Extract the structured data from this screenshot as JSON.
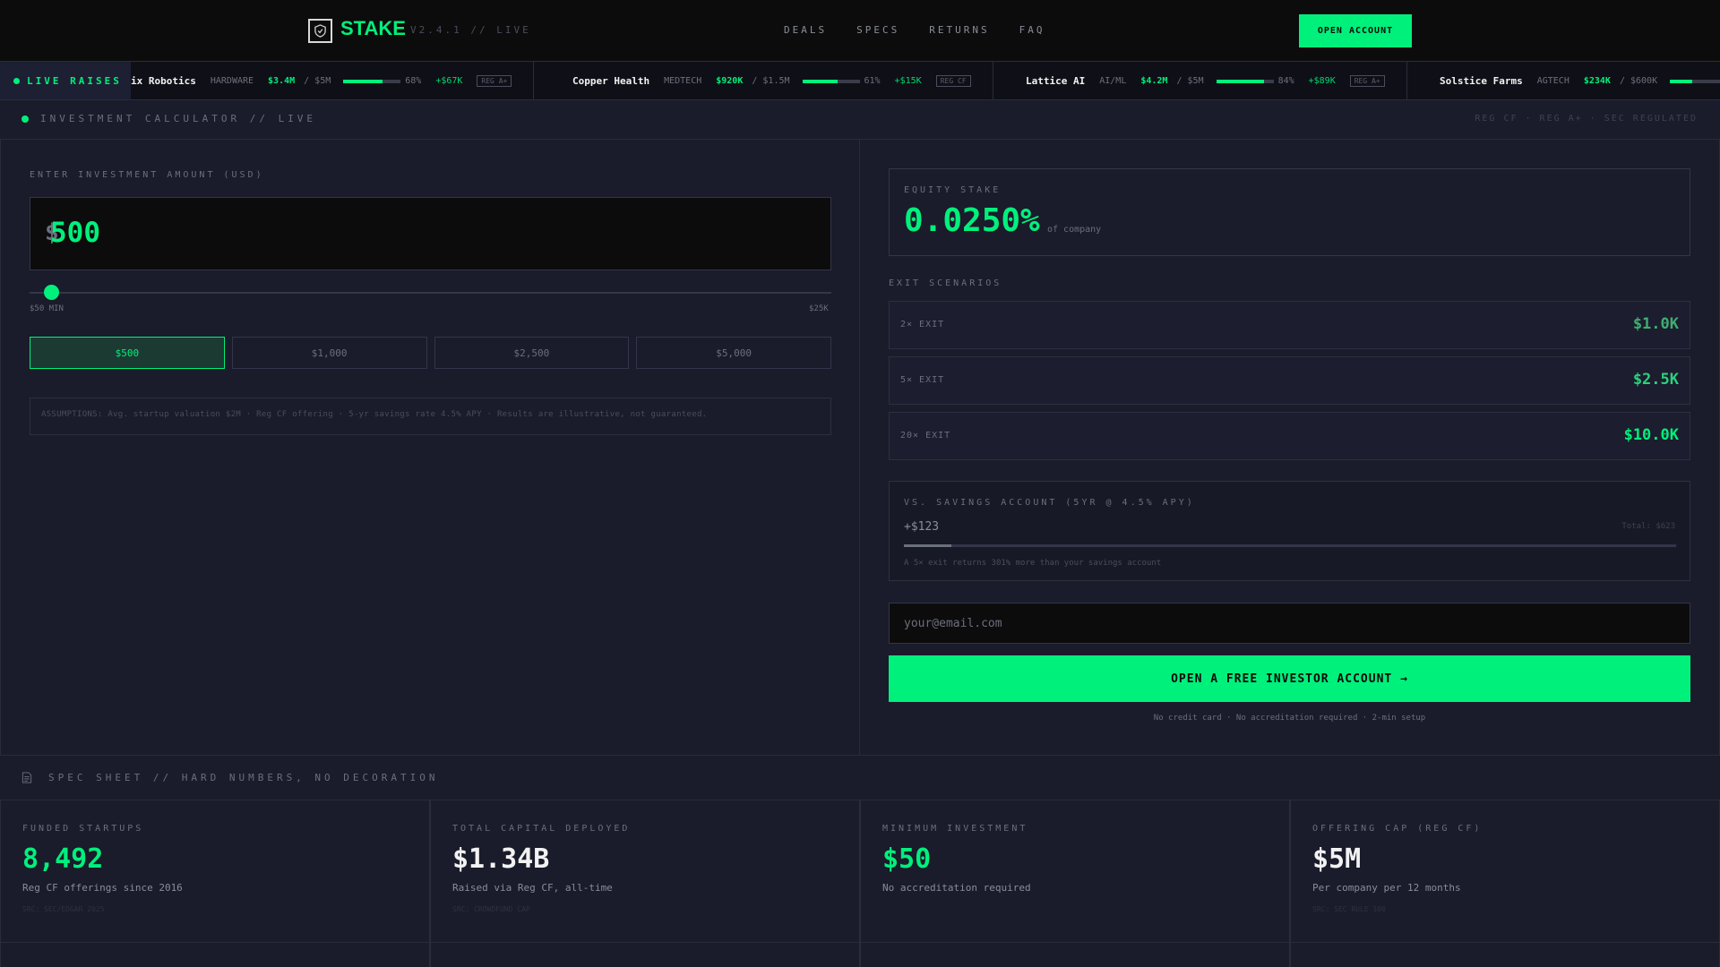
{
  "colors": {
    "accent": "#00f07c",
    "bg": "#1a1b2b",
    "header_bg": "#0c0c0c"
  },
  "header": {
    "logo_icon": "shield-icon",
    "brand": "STAKE",
    "version": "V2.4.1 // LIVE",
    "nav": [
      "DEALS",
      "SPECS",
      "RETURNS",
      "FAQ"
    ],
    "cta": "OPEN ACCOUNT"
  },
  "ticker": {
    "label": "LIVE RAISES",
    "items": [
      {
        "name": "ix Robotics",
        "sector": "HARDWARE",
        "raised": "$3.4M",
        "goal": "/ $5M",
        "progress": 0.68,
        "pct": "68%",
        "delta": "+$67K",
        "reg": "REG A+"
      },
      {
        "name": "Copper Health",
        "sector": "MEDTECH",
        "raised": "$920K",
        "goal": "/ $1.5M",
        "progress": 0.61,
        "pct": "61%",
        "delta": "+$15K",
        "reg": "REG CF"
      },
      {
        "name": "Lattice AI",
        "sector": "AI/ML",
        "raised": "$4.2M",
        "goal": "/ $5M",
        "progress": 0.84,
        "pct": "84%",
        "delta": "+$89K",
        "reg": "REG A+"
      },
      {
        "name": "Solstice Farms",
        "sector": "AGTECH",
        "raised": "$234K",
        "goal": "/ $600K",
        "progress": 0.39
      }
    ]
  },
  "calculator": {
    "title": "INVESTMENT CALCULATOR // LIVE",
    "reg_note": "REG CF · REG A+ · SEC REGULATED",
    "input_label": "ENTER INVESTMENT AMOUNT (USD)",
    "currency": "$",
    "amount": "500",
    "slider_min": "$50 MIN",
    "slider_max": "$25K",
    "slider_value": 0.018,
    "presets": [
      "$500",
      "$1,000",
      "$2,500",
      "$5,000"
    ],
    "assumptions": "ASSUMPTIONS: Avg. startup valuation $2M · Reg CF offering · 5-yr savings rate 4.5% APY · Results are illustrative, not guaranteed."
  },
  "results": {
    "equity_label": "EQUITY STAKE",
    "equity_value": "0.0250%",
    "equity_sub": "of company",
    "exit_label": "EXIT SCENARIOS",
    "exits": [
      {
        "label": "2× EXIT",
        "value": "$1.0K"
      },
      {
        "label": "5× EXIT",
        "value": "$2.5K"
      },
      {
        "label": "20× EXIT",
        "value": "$10.0K"
      }
    ],
    "savings_label": "VS. SAVINGS ACCOUNT (5YR @ 4.5% APY)",
    "savings_gain": "+$123",
    "savings_total": "Total: $623",
    "savings_progress": 0.062,
    "savings_note": "A 5× exit returns 301% more than your savings account",
    "email_placeholder": "your@email.com",
    "cta": "OPEN A FREE INVESTOR ACCOUNT →",
    "fine_print": "No credit card · No accreditation required · 2-min setup"
  },
  "spec": {
    "title": "SPEC SHEET // HARD NUMBERS, NO DECORATION",
    "icon": "document-icon",
    "stats": [
      {
        "label": "FUNDED STARTUPS",
        "value": "8,492",
        "desc": "Reg CF offerings since 2016",
        "source": "SRC: SEC/EDGAR 2025"
      },
      {
        "label": "TOTAL CAPITAL DEPLOYED",
        "value": "$1.34B",
        "desc": "Raised via Reg CF, all-time",
        "source": "SRC: CROWDFUND CAP"
      },
      {
        "label": "MINIMUM INVESTMENT",
        "value": "$50",
        "desc": "No accreditation required",
        "source": ""
      },
      {
        "label": "OFFERING CAP (REG CF)",
        "value": "$5M",
        "desc": "Per company per 12 months",
        "source": "SRC: SEC RULE 100"
      }
    ]
  }
}
